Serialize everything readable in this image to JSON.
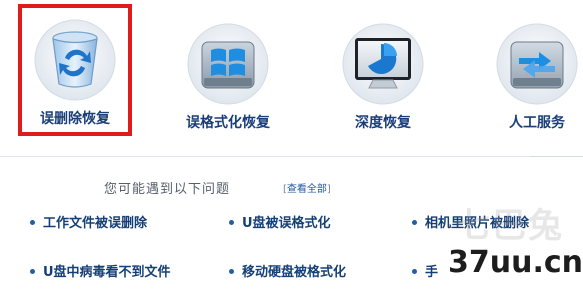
{
  "services": [
    {
      "label": "误删除恢复",
      "icon": "recycle-bin-icon"
    },
    {
      "label": "误格式化恢复",
      "icon": "windows-disk-icon"
    },
    {
      "label": "深度恢复",
      "icon": "pie-chart-monitor-icon"
    },
    {
      "label": "人工服务",
      "icon": "transfer-arrows-icon"
    }
  ],
  "faq": {
    "title": "您可能遇到以下问题",
    "view_all": "查看全部",
    "items": [
      "工作文件被误删除",
      "U盘被误格式化",
      "相机里照片被删除",
      "U盘中病毒看不到文件",
      "移动硬盘被格式化",
      "手"
    ]
  },
  "watermark": {
    "main": "37uu.cn",
    "faint": "七巴兔"
  },
  "colors": {
    "selected_border": "#e01b1b",
    "label_text": "#1a3e78",
    "accent_blue": "#1f5aa0"
  }
}
